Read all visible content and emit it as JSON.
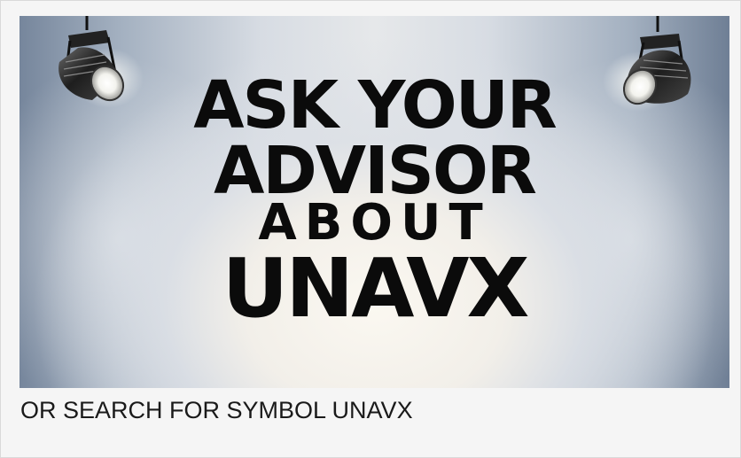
{
  "banner": {
    "line1": "ASK YOUR",
    "line2": "ADVISOR",
    "line3": "ABOUT",
    "line4": "UNAVX",
    "left_light_icon": "spotlight-icon",
    "right_light_icon": "spotlight-icon"
  },
  "caption": "OR SEARCH FOR SYMBOL UNAVX",
  "colors": {
    "headline": "#0b0b0b",
    "background_edge": "#76869c",
    "background_center": "#f6f3ee"
  }
}
